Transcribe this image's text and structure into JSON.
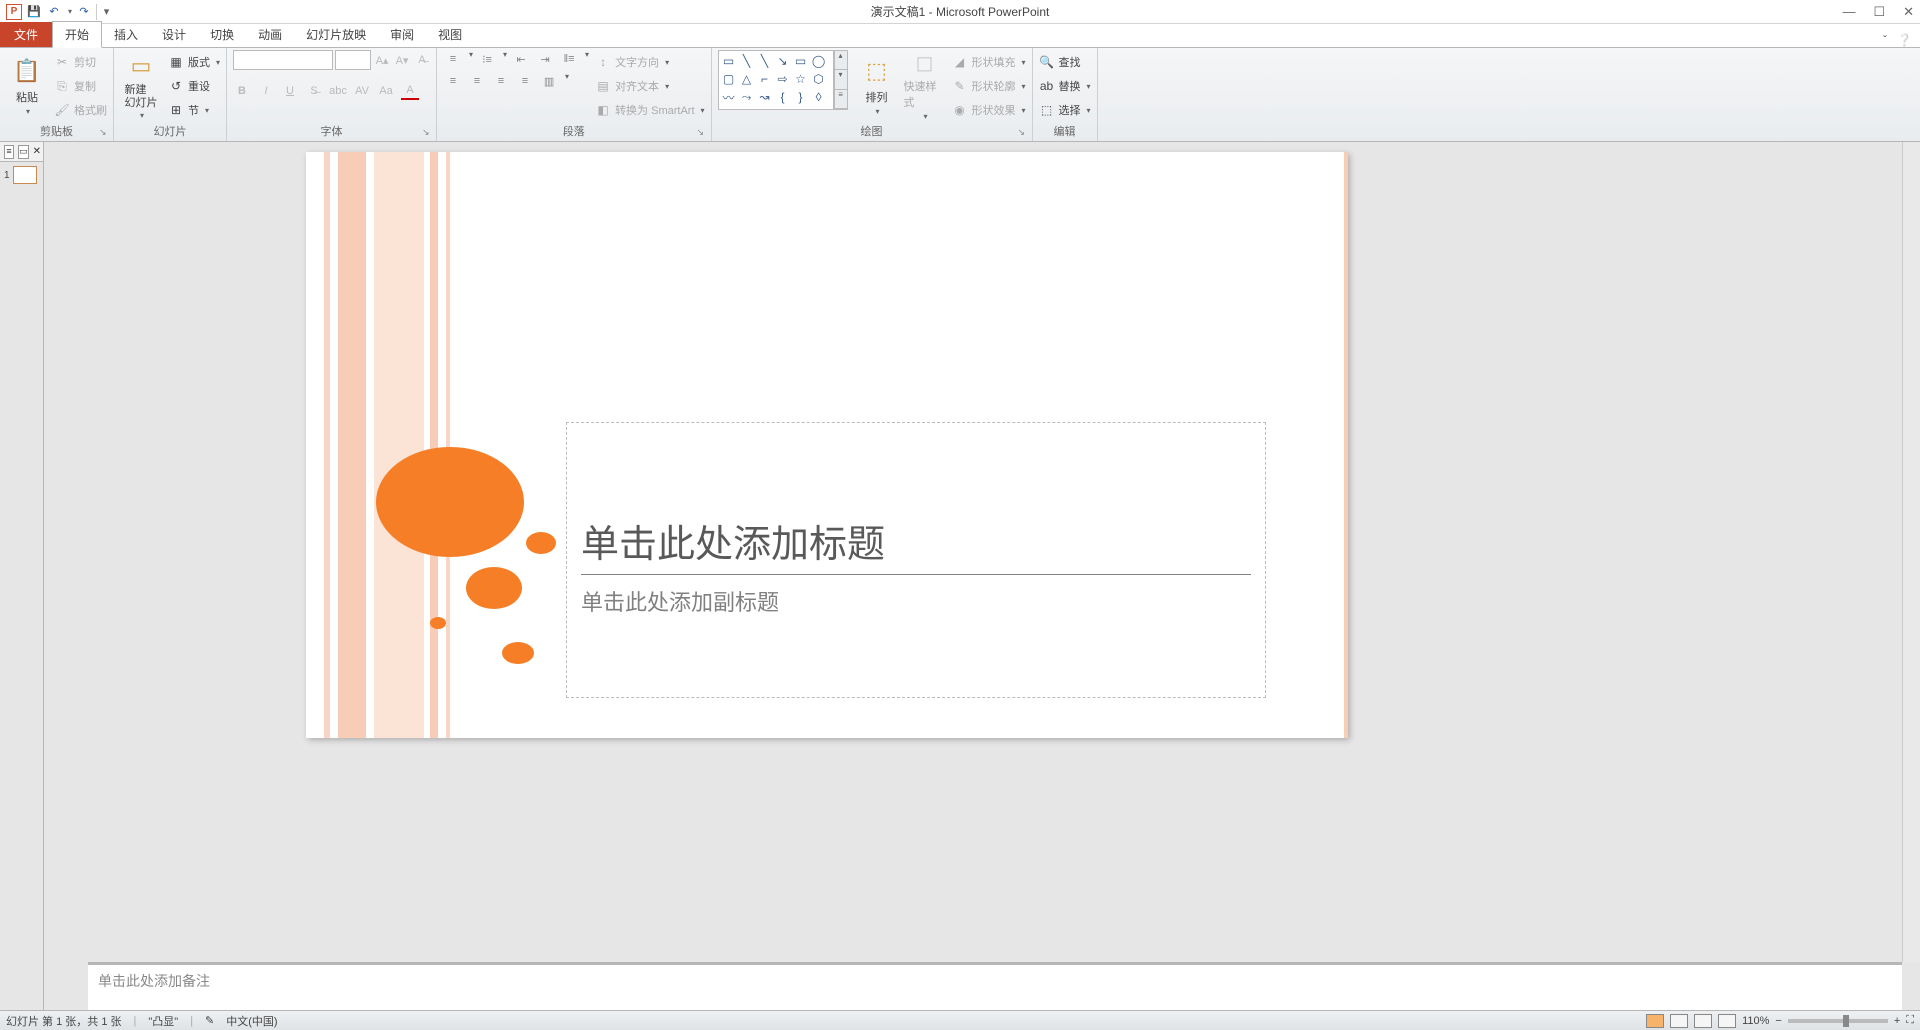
{
  "title_bar": {
    "doc_title": "演示文稿1 - Microsoft PowerPoint"
  },
  "tabs": {
    "file": "文件",
    "home": "开始",
    "insert": "插入",
    "design": "设计",
    "transitions": "切换",
    "animations": "动画",
    "slideshow": "幻灯片放映",
    "review": "审阅",
    "view": "视图"
  },
  "ribbon": {
    "clipboard": {
      "label": "剪贴板",
      "paste": "粘贴",
      "cut": "剪切",
      "copy": "复制",
      "format_painter": "格式刷"
    },
    "slides": {
      "label": "幻灯片",
      "new_slide": "新建\n幻灯片",
      "layout": "版式",
      "reset": "重设",
      "section": "节"
    },
    "font": {
      "label": "字体"
    },
    "paragraph": {
      "label": "段落",
      "text_direction": "文字方向",
      "align_text": "对齐文本",
      "convert_smartart": "转换为 SmartArt"
    },
    "drawing": {
      "label": "绘图",
      "arrange": "排列",
      "quick_styles": "快速样式",
      "shape_fill": "形状填充",
      "shape_outline": "形状轮廓",
      "shape_effects": "形状效果"
    },
    "editing": {
      "label": "编辑",
      "find": "查找",
      "replace": "替换",
      "select": "选择"
    }
  },
  "slide": {
    "title_placeholder": "单击此处添加标题",
    "subtitle_placeholder": "单击此处添加副标题",
    "notes_placeholder": "单击此处添加备注",
    "thumb_num": "1"
  },
  "status": {
    "slide_info": "幻灯片 第 1 张，共 1 张",
    "theme": "\"凸显\"",
    "language": "中文(中国)",
    "zoom": "110%"
  },
  "colors": {
    "accent": "#f57e26",
    "file_tab": "#c8442a"
  }
}
